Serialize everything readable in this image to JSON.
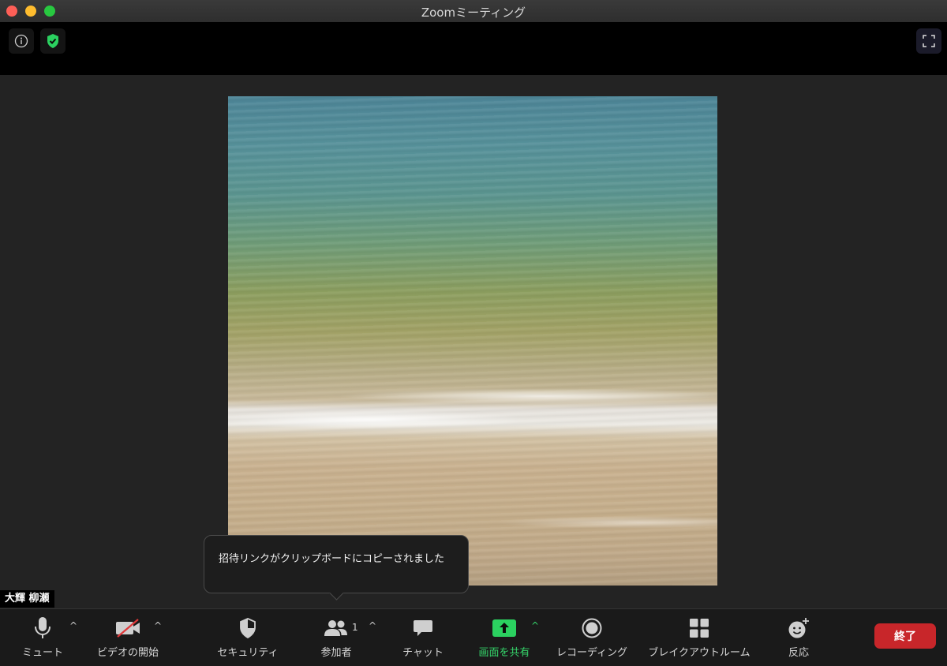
{
  "window": {
    "title": "Zoomミーティング"
  },
  "participant": {
    "name": "大輝 柳瀬"
  },
  "toast": {
    "message": "招待リンクがクリップボードにコピーされました"
  },
  "toolbar": {
    "mute": "ミュート",
    "video": "ビデオの開始",
    "security": "セキュリティ",
    "participants": "参加者",
    "participants_count": "1",
    "chat": "チャット",
    "share": "画面を共有",
    "record": "レコーディング",
    "breakout": "ブレイクアウトルーム",
    "reactions": "反応",
    "end": "終了"
  },
  "colors": {
    "accent_green": "#35d46a",
    "end_red": "#c8262a",
    "toolbar_bg": "#1a1a1a"
  }
}
